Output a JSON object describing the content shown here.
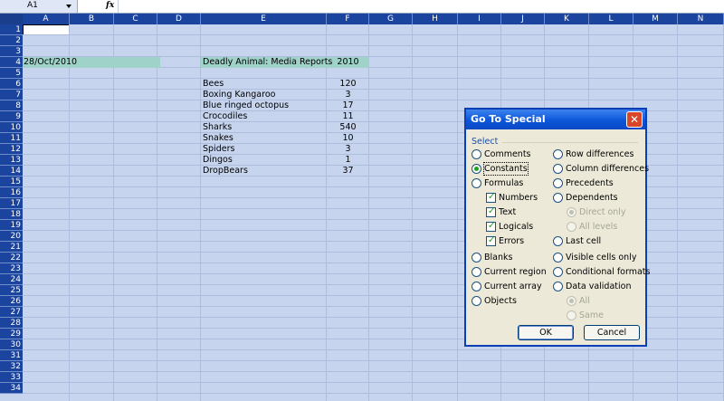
{
  "formula_bar": {
    "name_box": "A1",
    "fx_label": "fx",
    "formula": ""
  },
  "columns": [
    "A",
    "B",
    "C",
    "D",
    "E",
    "F",
    "G",
    "H",
    "I",
    "J",
    "K",
    "L",
    "M",
    "N"
  ],
  "rows": [
    "1",
    "2",
    "3",
    "4",
    "5",
    "6",
    "7",
    "8",
    "9",
    "10",
    "11",
    "12",
    "13",
    "14",
    "15",
    "16",
    "17",
    "18",
    "19",
    "20",
    "21",
    "22",
    "23",
    "24",
    "25",
    "26",
    "27",
    "28",
    "29",
    "30",
    "31",
    "32",
    "33",
    "34"
  ],
  "cells": {
    "date": "28/Oct/2010",
    "title": "Deadly Animal: Media Reports",
    "year": "2010",
    "animals": [
      {
        "name": "Bees",
        "value": "120"
      },
      {
        "name": "Boxing Kangaroo",
        "value": "3"
      },
      {
        "name": "Blue ringed octopus",
        "value": "17"
      },
      {
        "name": "Crocodiles",
        "value": "11"
      },
      {
        "name": "Sharks",
        "value": "540"
      },
      {
        "name": "Snakes",
        "value": "10"
      },
      {
        "name": "Spiders",
        "value": "3"
      },
      {
        "name": "Dingos",
        "value": "1"
      },
      {
        "name": "DropBears",
        "value": "37"
      }
    ]
  },
  "colors": {
    "band": "#9fd2c8",
    "header": "#1b449e",
    "sheet": "#c6d4ee"
  },
  "dialog": {
    "title": "Go To Special",
    "close_label": "✕",
    "group_label": "Select",
    "options_left": [
      {
        "label": "Comments",
        "type": "radio",
        "selected": false
      },
      {
        "label": "Constants",
        "type": "radio",
        "selected": true
      },
      {
        "label": "Formulas",
        "type": "radio",
        "selected": false
      },
      {
        "label": "Numbers",
        "type": "checkbox",
        "checked": true
      },
      {
        "label": "Text",
        "type": "checkbox",
        "checked": true
      },
      {
        "label": "Logicals",
        "type": "checkbox",
        "checked": true
      },
      {
        "label": "Errors",
        "type": "checkbox",
        "checked": true
      },
      {
        "label": "Blanks",
        "type": "radio",
        "selected": false
      },
      {
        "label": "Current region",
        "type": "radio",
        "selected": false
      },
      {
        "label": "Current array",
        "type": "radio",
        "selected": false
      },
      {
        "label": "Objects",
        "type": "radio",
        "selected": false
      }
    ],
    "options_right": [
      {
        "label": "Row differences",
        "type": "radio",
        "selected": false
      },
      {
        "label": "Column differences",
        "type": "radio",
        "selected": false
      },
      {
        "label": "Precedents",
        "type": "radio",
        "selected": false
      },
      {
        "label": "Dependents",
        "type": "radio",
        "selected": false
      },
      {
        "label": "Direct only",
        "type": "radio",
        "selected": true,
        "disabled": true
      },
      {
        "label": "All levels",
        "type": "radio",
        "selected": false,
        "disabled": true
      },
      {
        "label": "Last cell",
        "type": "radio",
        "selected": false
      },
      {
        "label": "Visible cells only",
        "type": "radio",
        "selected": false
      },
      {
        "label": "Conditional formats",
        "type": "radio",
        "selected": false
      },
      {
        "label": "Data validation",
        "type": "radio",
        "selected": false
      },
      {
        "label": "All",
        "type": "radio",
        "selected": true,
        "disabled": true
      },
      {
        "label": "Same",
        "type": "radio",
        "selected": false,
        "disabled": true
      }
    ],
    "ok_label": "OK",
    "cancel_label": "Cancel"
  }
}
